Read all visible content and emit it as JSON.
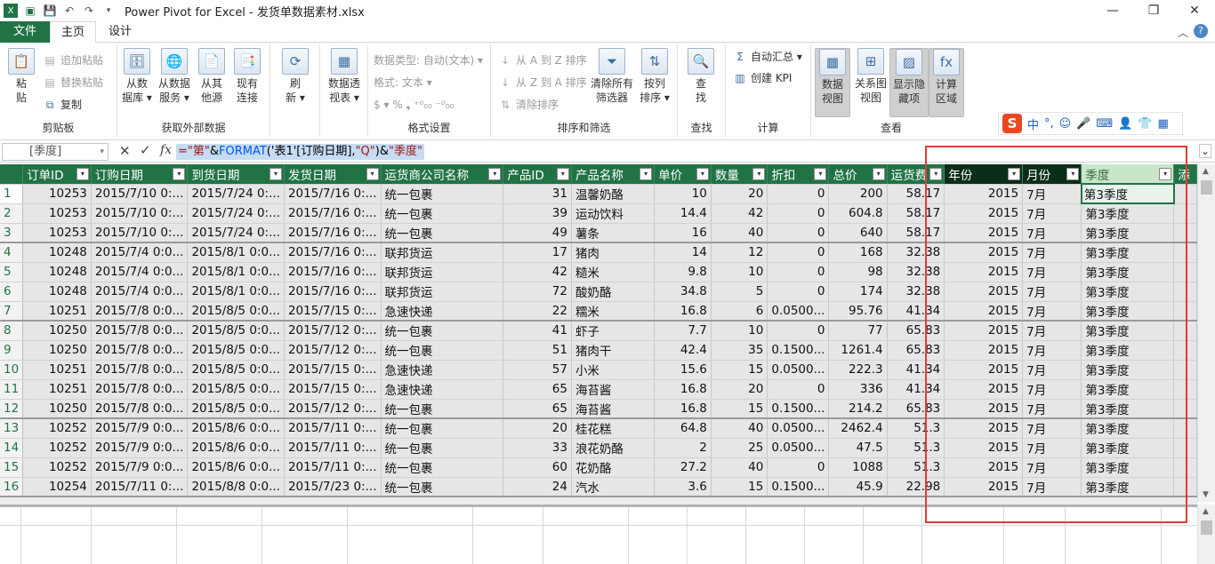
{
  "window": {
    "title": "Power Pivot for Excel - 发货单数据素材.xlsx"
  },
  "tabs": {
    "file": "文件",
    "home": "主页",
    "design": "设计"
  },
  "ribbon": {
    "clipboard": {
      "title": "剪贴板",
      "paste": "粘\n贴",
      "paste_append": "追加粘贴",
      "paste_replace": "替换粘贴",
      "copy": "复制"
    },
    "external": {
      "title": "获取外部数据",
      "from_db": "从数\n据库 ▾",
      "from_service": "从数据\n服务 ▾",
      "from_other": "从其\n他源",
      "existing": "现有\n连接"
    },
    "refresh": {
      "label": "刷\n新 ▾"
    },
    "pivot": {
      "label": "数据透\n视表 ▾"
    },
    "format": {
      "title": "格式设置",
      "datatype": "数据类型: 自动(文本) ▾",
      "format": "格式: 文本 ▾",
      "symbols": "$ ▾  %  ❟  ⁺⁰₀₀  ⁻⁰₀₀"
    },
    "sort": {
      "title": "排序和筛选",
      "az": "从 A 到 Z 排序",
      "za": "从 Z 到 A 排序",
      "clear_sort": "清除排序",
      "clear_filters": "清除所有\n筛选器",
      "by_column": "按列\n排序 ▾"
    },
    "find": {
      "title": "查找",
      "label": "查\n找"
    },
    "calc": {
      "title": "计算",
      "autosum": "自动汇总 ▾",
      "kpi": "创建 KPI"
    },
    "view": {
      "title": "查看",
      "data_view": "数据\n视图",
      "diagram_view": "关系图\n视图",
      "show_hidden": "显示隐\n藏项",
      "calc_area": "计算\n区域"
    }
  },
  "ime": {
    "logo": "S",
    "items": [
      "中",
      "°,",
      "☺",
      "🎤",
      "⌨",
      "👤",
      "👕",
      "▦"
    ]
  },
  "formula_bar": {
    "name_box": "[季度]",
    "fx": "fx",
    "parts": {
      "p1": "=\"第\"",
      "p2": "&",
      "p3": "FORMAT",
      "p4": "('表1'[订购日期],",
      "p5": "\"Q\"",
      "p6": ")&",
      "p7": "\"季度\""
    }
  },
  "table": {
    "columns": [
      "订单ID",
      "订购日期",
      "到货日期",
      "发货日期",
      "运货商公司名称",
      "产品ID",
      "产品名称",
      "单价",
      "数量",
      "折扣",
      "总价",
      "运货费",
      "年份",
      "月份",
      "季度",
      "添"
    ],
    "rows": [
      [
        "1",
        "10253",
        "2015/7/10 0:...",
        "2015/7/24 0:...",
        "2015/7/16 0:...",
        "统一包裹",
        "31",
        "温馨奶酪",
        "10",
        "20",
        "0",
        "200",
        "58.17",
        "2015",
        "7月",
        "第3季度"
      ],
      [
        "2",
        "10253",
        "2015/7/10 0:...",
        "2015/7/24 0:...",
        "2015/7/16 0:...",
        "统一包裹",
        "39",
        "运动饮料",
        "14.4",
        "42",
        "0",
        "604.8",
        "58.17",
        "2015",
        "7月",
        "第3季度"
      ],
      [
        "3",
        "10253",
        "2015/7/10 0:...",
        "2015/7/24 0:...",
        "2015/7/16 0:...",
        "统一包裹",
        "49",
        "薯条",
        "16",
        "40",
        "0",
        "640",
        "58.17",
        "2015",
        "7月",
        "第3季度"
      ],
      [
        "4",
        "10248",
        "2015/7/4 0:0...",
        "2015/8/1 0:0...",
        "2015/7/16 0:...",
        "联邦货运",
        "17",
        "猪肉",
        "14",
        "12",
        "0",
        "168",
        "32.38",
        "2015",
        "7月",
        "第3季度"
      ],
      [
        "5",
        "10248",
        "2015/7/4 0:0...",
        "2015/8/1 0:0...",
        "2015/7/16 0:...",
        "联邦货运",
        "42",
        "糙米",
        "9.8",
        "10",
        "0",
        "98",
        "32.38",
        "2015",
        "7月",
        "第3季度"
      ],
      [
        "6",
        "10248",
        "2015/7/4 0:0...",
        "2015/8/1 0:0...",
        "2015/7/16 0:...",
        "联邦货运",
        "72",
        "酸奶酪",
        "34.8",
        "5",
        "0",
        "174",
        "32.38",
        "2015",
        "7月",
        "第3季度"
      ],
      [
        "7",
        "10251",
        "2015/7/8 0:0...",
        "2015/8/5 0:0...",
        "2015/7/15 0:...",
        "急速快递",
        "22",
        "糯米",
        "16.8",
        "6",
        "0.0500...",
        "95.76",
        "41.34",
        "2015",
        "7月",
        "第3季度"
      ],
      [
        "8",
        "10250",
        "2015/7/8 0:0...",
        "2015/8/5 0:0...",
        "2015/7/12 0:...",
        "统一包裹",
        "41",
        "虾子",
        "7.7",
        "10",
        "0",
        "77",
        "65.83",
        "2015",
        "7月",
        "第3季度"
      ],
      [
        "9",
        "10250",
        "2015/7/8 0:0...",
        "2015/8/5 0:0...",
        "2015/7/12 0:...",
        "统一包裹",
        "51",
        "猪肉干",
        "42.4",
        "35",
        "0.1500...",
        "1261.4",
        "65.83",
        "2015",
        "7月",
        "第3季度"
      ],
      [
        "10",
        "10251",
        "2015/7/8 0:0...",
        "2015/8/5 0:0...",
        "2015/7/15 0:...",
        "急速快递",
        "57",
        "小米",
        "15.6",
        "15",
        "0.0500...",
        "222.3",
        "41.34",
        "2015",
        "7月",
        "第3季度"
      ],
      [
        "11",
        "10251",
        "2015/7/8 0:0...",
        "2015/8/5 0:0...",
        "2015/7/15 0:...",
        "急速快递",
        "65",
        "海苔酱",
        "16.8",
        "20",
        "0",
        "336",
        "41.34",
        "2015",
        "7月",
        "第3季度"
      ],
      [
        "12",
        "10250",
        "2015/7/8 0:0...",
        "2015/8/5 0:0...",
        "2015/7/12 0:...",
        "统一包裹",
        "65",
        "海苔酱",
        "16.8",
        "15",
        "0.1500...",
        "214.2",
        "65.83",
        "2015",
        "7月",
        "第3季度"
      ],
      [
        "13",
        "10252",
        "2015/7/9 0:0...",
        "2015/8/6 0:0...",
        "2015/7/11 0:...",
        "统一包裹",
        "20",
        "桂花糕",
        "64.8",
        "40",
        "0.0500...",
        "2462.4",
        "51.3",
        "2015",
        "7月",
        "第3季度"
      ],
      [
        "14",
        "10252",
        "2015/7/9 0:0...",
        "2015/8/6 0:0...",
        "2015/7/11 0:...",
        "统一包裹",
        "33",
        "浪花奶酪",
        "2",
        "25",
        "0.0500...",
        "47.5",
        "51.3",
        "2015",
        "7月",
        "第3季度"
      ],
      [
        "15",
        "10252",
        "2015/7/9 0:0...",
        "2015/8/6 0:0...",
        "2015/7/11 0:...",
        "统一包裹",
        "60",
        "花奶酪",
        "27.2",
        "40",
        "0",
        "1088",
        "51.3",
        "2015",
        "7月",
        "第3季度"
      ],
      [
        "16",
        "10254",
        "2015/7/11 0:...",
        "2015/8/8 0:0...",
        "2015/7/23 0:...",
        "统一包裹",
        "24",
        "汽水",
        "3.6",
        "15",
        "0.1500...",
        "45.9",
        "22.98",
        "2015",
        "7月",
        "第3季度"
      ]
    ]
  },
  "colors": {
    "header_green": "#217346",
    "calc_col_header": "#0b2e18",
    "selected_col_header": "#c8e6c9",
    "highlight_box": "#e23a3a"
  }
}
